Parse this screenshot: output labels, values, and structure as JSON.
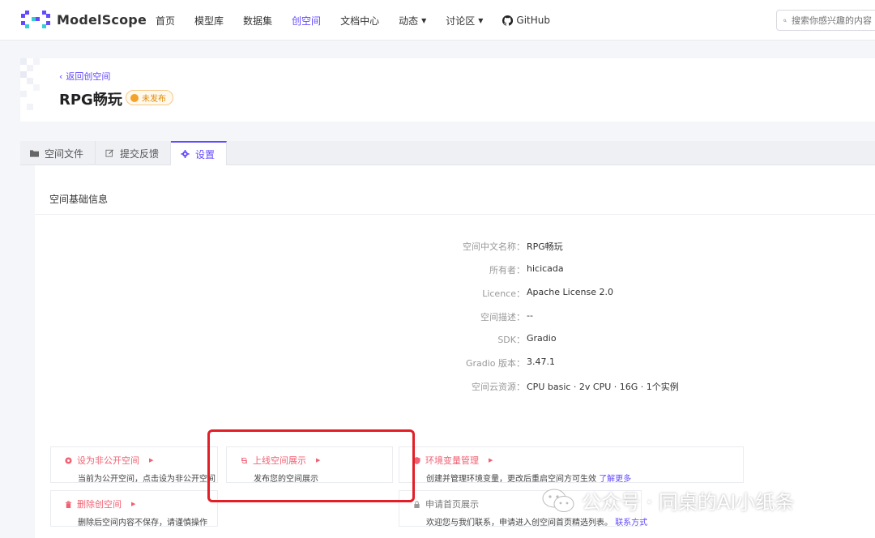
{
  "brand": {
    "name": "ModelScope"
  },
  "nav": {
    "items": [
      {
        "label": "首页",
        "active": false,
        "dropdown": false
      },
      {
        "label": "模型库",
        "active": false,
        "dropdown": false
      },
      {
        "label": "数据集",
        "active": false,
        "dropdown": false
      },
      {
        "label": "创空间",
        "active": true,
        "dropdown": false
      },
      {
        "label": "文档中心",
        "active": false,
        "dropdown": false
      },
      {
        "label": "动态",
        "active": false,
        "dropdown": true
      },
      {
        "label": "讨论区",
        "active": false,
        "dropdown": true
      }
    ],
    "github_label": "GitHub",
    "search_placeholder": "搜索你感兴趣的内容"
  },
  "header": {
    "back_label": "返回创空间",
    "title": "RPG畅玩",
    "status_badge": "未发布"
  },
  "tabs": [
    {
      "label": "空间文件",
      "icon": "folder-icon",
      "active": false
    },
    {
      "label": "提交反馈",
      "icon": "edit-icon",
      "active": false
    },
    {
      "label": "设置",
      "icon": "gear-icon",
      "active": true
    }
  ],
  "settings": {
    "section_title": "空间基础信息",
    "info": [
      {
        "label": "空间中文名称：",
        "value": "RPG畅玩"
      },
      {
        "label": "所有者：",
        "value": "hicicada"
      },
      {
        "label": "Licence：",
        "value": "Apache License 2.0"
      },
      {
        "label": "空间描述：",
        "value": "--"
      },
      {
        "label": "SDK：",
        "value": "Gradio"
      },
      {
        "label": "Gradio 版本：",
        "value": "3.47.1"
      },
      {
        "label": "空间云资源：",
        "value": "CPU basic · 2v CPU · 16G · 1个实例"
      }
    ],
    "actions": {
      "make_private": {
        "title": "设为非公开空间",
        "desc": "当前为公开空间，点击设为非公开空间"
      },
      "publish": {
        "title": "上线空间展示",
        "desc": "发布您的空间展示"
      },
      "env_vars": {
        "title": "环境变量管理",
        "desc": "创建并管理环境变量，更改后重启空间方可生效",
        "link": "了解更多"
      },
      "delete": {
        "title": "删除创空间",
        "desc": "删除后空间内容不保存，请谨慎操作"
      },
      "homepage": {
        "title": "申请首页展示",
        "desc": "欢迎您与我们联系，申请进入创空间首页精选列表。",
        "link": "联系方式"
      }
    }
  },
  "watermark": {
    "text": "公众号 · 同桌的AI小纸条"
  },
  "colors": {
    "accent": "#624aff",
    "danger": "#ef6173",
    "warning": "#f3a22b",
    "highlight": "#e31e26"
  }
}
